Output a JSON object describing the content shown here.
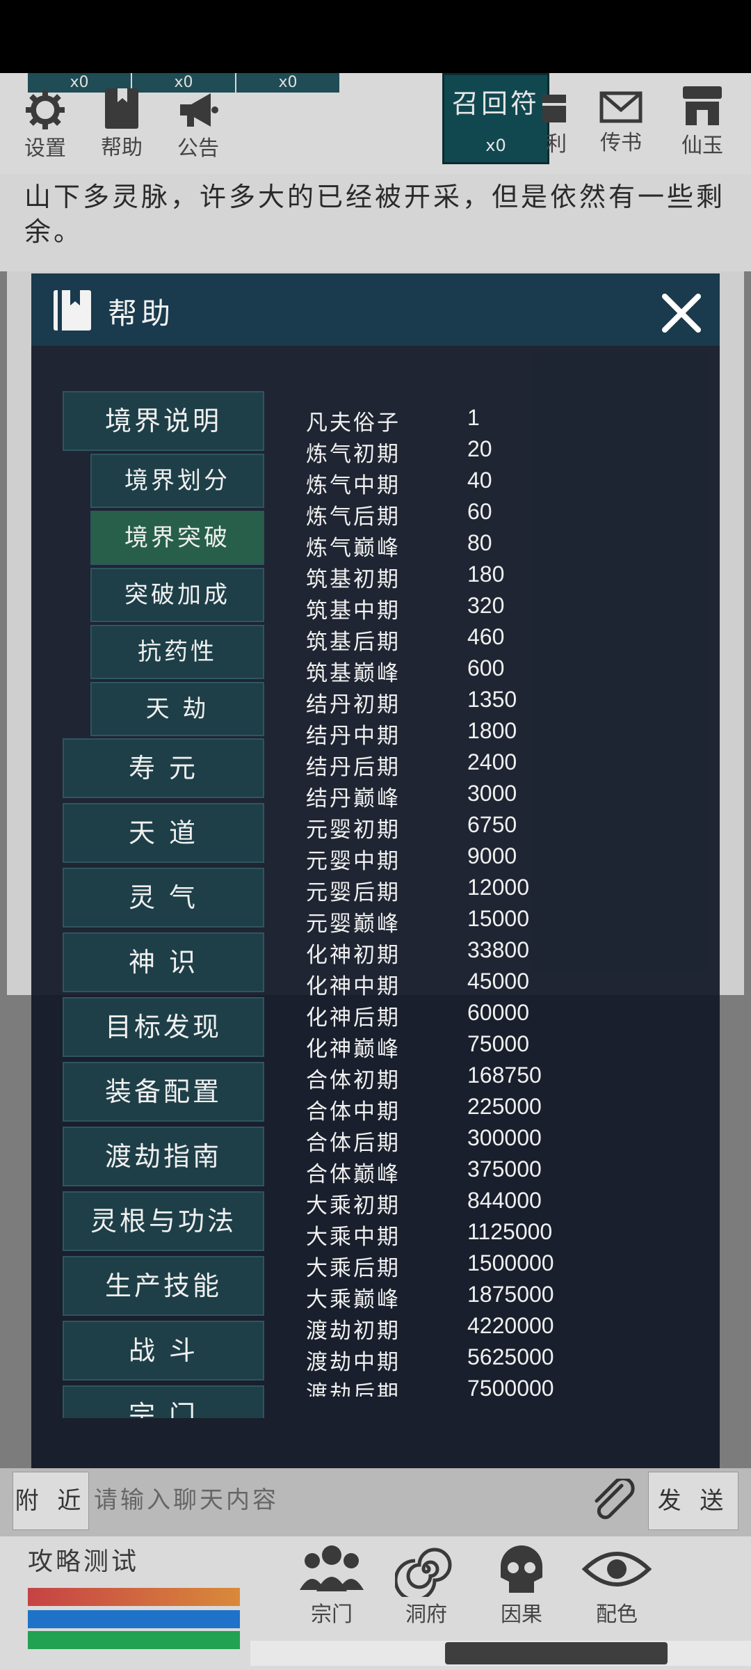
{
  "top_slots": [
    "x0",
    "x0",
    "x0"
  ],
  "top_icons": {
    "settings": "设置",
    "help": "帮助",
    "notice": "公告",
    "welfare_partial": "利",
    "mail": "传书",
    "shop": "仙玉"
  },
  "recall": {
    "label": "召回符",
    "count": "x0"
  },
  "story_text": "山下多灵脉，许多大的已经被开采，但是依然有一些剩余。",
  "dialog": {
    "title": "帮助",
    "nav": [
      {
        "label": "境界说明",
        "kind": "main"
      },
      {
        "label": "境界划分",
        "kind": "sub"
      },
      {
        "label": "境界突破",
        "kind": "sub"
      },
      {
        "label": "突破加成",
        "kind": "sub"
      },
      {
        "label": "抗药性",
        "kind": "sub"
      },
      {
        "label": "天 劫",
        "kind": "sub"
      },
      {
        "label": "寿 元",
        "kind": "main"
      },
      {
        "label": "天 道",
        "kind": "main"
      },
      {
        "label": "灵 气",
        "kind": "main"
      },
      {
        "label": "神 识",
        "kind": "main"
      },
      {
        "label": "目标发现",
        "kind": "main"
      },
      {
        "label": "装备配置",
        "kind": "main"
      },
      {
        "label": "渡劫指南",
        "kind": "main"
      },
      {
        "label": "灵根与功法",
        "kind": "main"
      },
      {
        "label": "生产技能",
        "kind": "main"
      },
      {
        "label": "战 斗",
        "kind": "main"
      },
      {
        "label": "宗 门",
        "kind": "main"
      }
    ],
    "realm_table": [
      [
        "凡夫俗子",
        "1"
      ],
      [
        "炼气初期",
        "20"
      ],
      [
        "炼气中期",
        "40"
      ],
      [
        "炼气后期",
        "60"
      ],
      [
        "炼气巅峰",
        "80"
      ],
      [
        "筑基初期",
        "180"
      ],
      [
        "筑基中期",
        "320"
      ],
      [
        "筑基后期",
        "460"
      ],
      [
        "筑基巅峰",
        "600"
      ],
      [
        "结丹初期",
        "1350"
      ],
      [
        "结丹中期",
        "1800"
      ],
      [
        "结丹后期",
        "2400"
      ],
      [
        "结丹巅峰",
        "3000"
      ],
      [
        "元婴初期",
        "6750"
      ],
      [
        "元婴中期",
        "9000"
      ],
      [
        "元婴后期",
        "12000"
      ],
      [
        "元婴巅峰",
        "15000"
      ],
      [
        "化神初期",
        "33800"
      ],
      [
        "化神中期",
        "45000"
      ],
      [
        "化神后期",
        "60000"
      ],
      [
        "化神巅峰",
        "75000"
      ],
      [
        "合体初期",
        "168750"
      ],
      [
        "合体中期",
        "225000"
      ],
      [
        "合体后期",
        "300000"
      ],
      [
        "合体巅峰",
        "375000"
      ],
      [
        "大乘初期",
        "844000"
      ],
      [
        "大乘中期",
        "1125000"
      ],
      [
        "大乘后期",
        "1500000"
      ],
      [
        "大乘巅峰",
        "1875000"
      ],
      [
        "渡劫初期",
        "4220000"
      ],
      [
        "渡劫中期",
        "5625000"
      ],
      [
        "渡劫后期",
        "7500000"
      ]
    ]
  },
  "chat": {
    "channel": "附 近",
    "placeholder": "请输入聊天内容",
    "send": "发 送"
  },
  "bottom": {
    "guide_label": "攻略测试",
    "bar_colors": [
      "#c64245",
      "#1e73c9",
      "#21a152"
    ],
    "nav": [
      "宗门",
      "洞府",
      "因果",
      "配色"
    ]
  }
}
